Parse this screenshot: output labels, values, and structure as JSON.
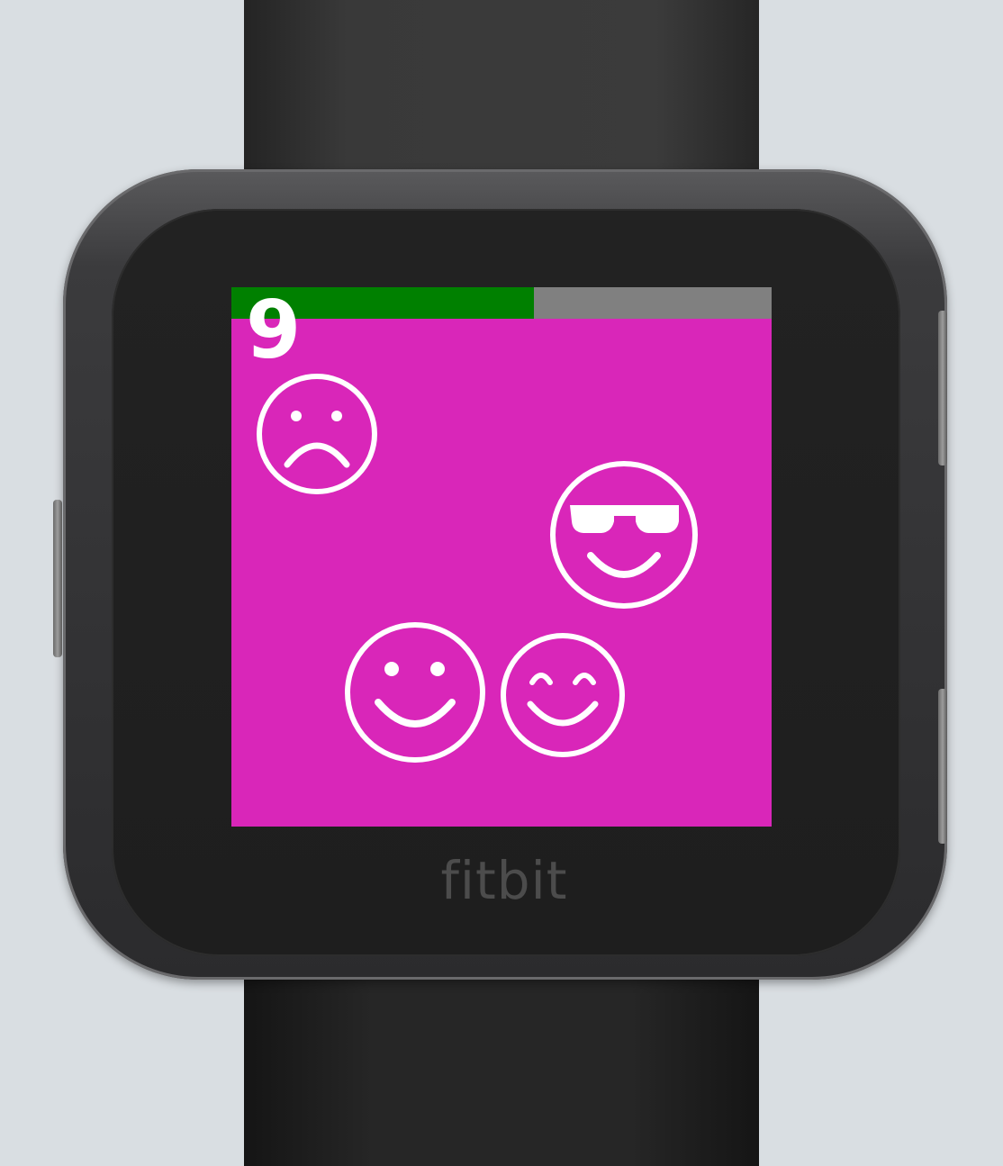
{
  "device": {
    "brand": "fitbit"
  },
  "game": {
    "score": "9",
    "progress": 0.56,
    "colors": {
      "background": "#d926b9",
      "progress_fill": "#008000",
      "progress_track": "#808080",
      "foreground": "#ffffff"
    },
    "faces": [
      {
        "kind": "sad-face-icon"
      },
      {
        "kind": "sunglasses-face-icon"
      },
      {
        "kind": "smiling-face-icon"
      },
      {
        "kind": "happy-closed-eyes-face-icon"
      }
    ]
  }
}
